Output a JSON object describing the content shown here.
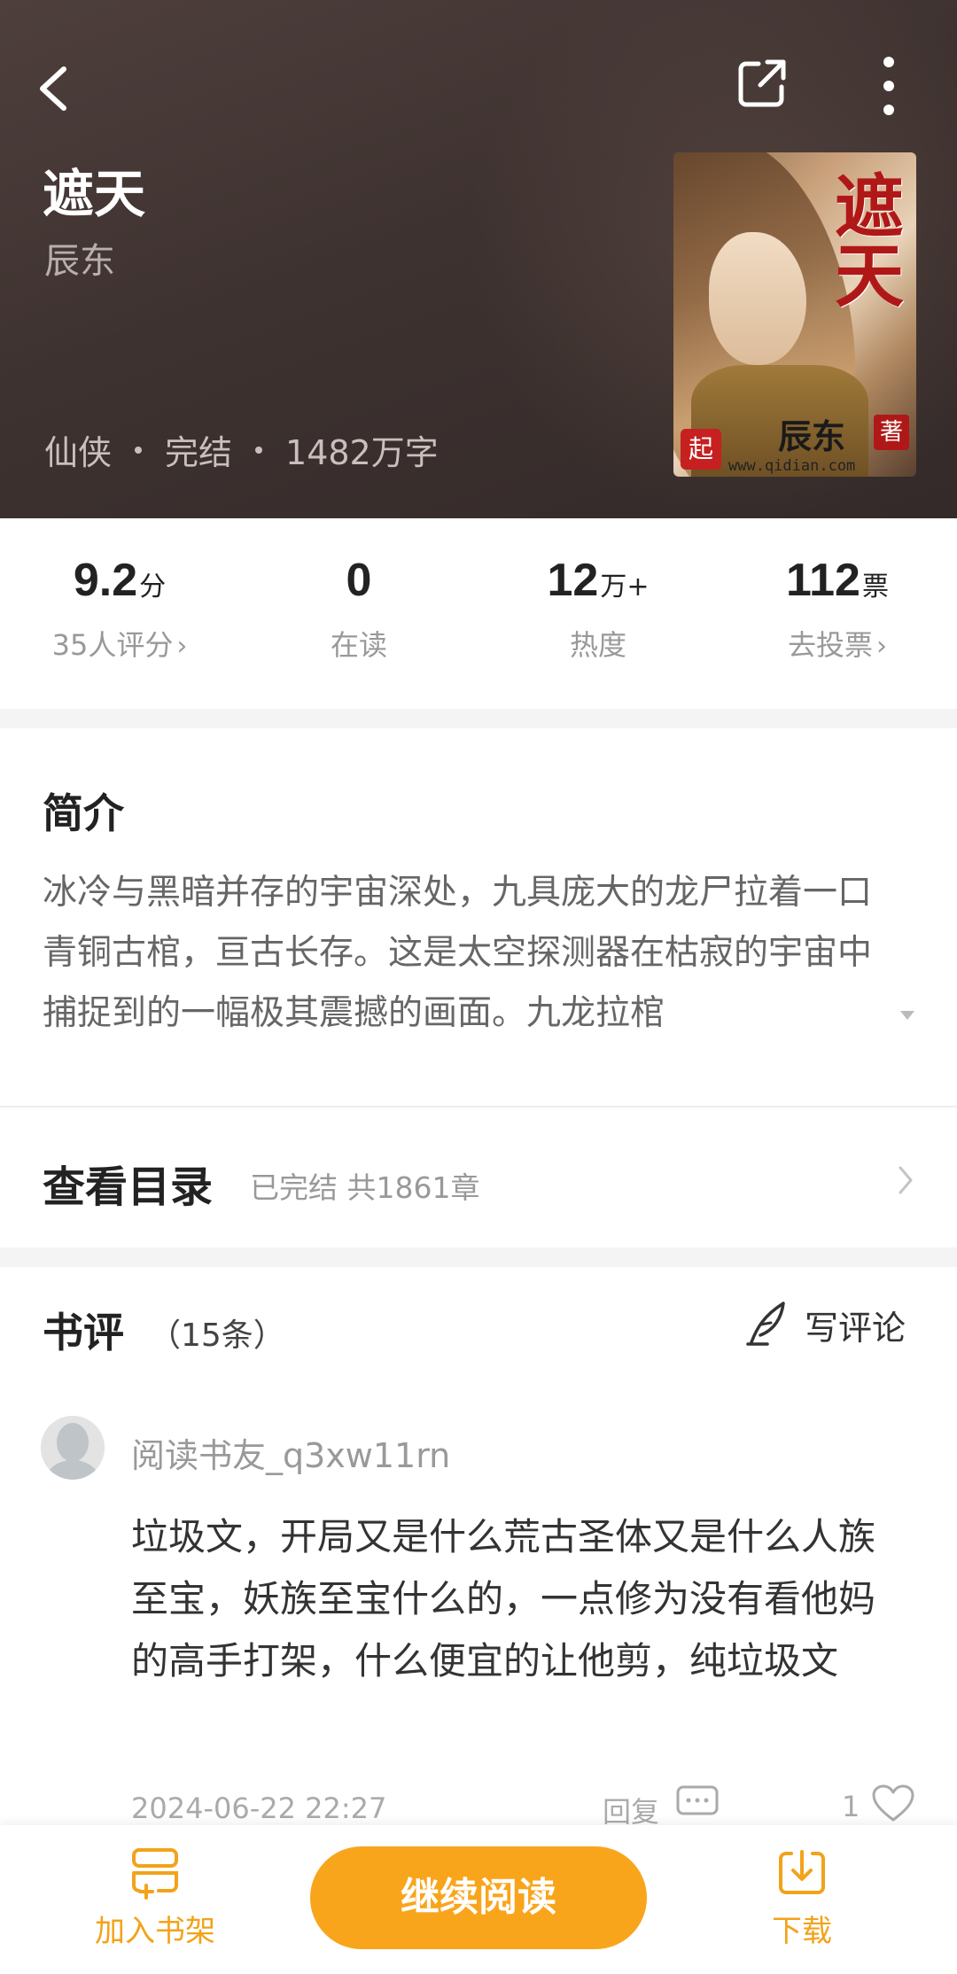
{
  "header": {
    "title": "遮天",
    "author": "辰东",
    "genre": "仙侠",
    "status": "完结",
    "word_count": "1482万字",
    "cover": {
      "title": "遮天",
      "author": "辰东",
      "zhu": "著",
      "seal": "起",
      "url": "www.qidian.com"
    }
  },
  "stats": {
    "rating": {
      "value": "9.2",
      "unit": "分",
      "label": "35人评分"
    },
    "reading": {
      "value": "0",
      "unit": "",
      "label": "在读"
    },
    "heat": {
      "value": "12",
      "unit": "万+",
      "label": "热度"
    },
    "votes": {
      "value": "112",
      "unit": "票",
      "label": "去投票"
    }
  },
  "intro": {
    "title": "简介",
    "text": "冰冷与黑暗并存的宇宙深处，九具庞大的龙尸拉着一口青铜古棺，亘古长存。这是太空探测器在枯寂的宇宙中捕捉到的一幅极其震撼的画面。九龙拉棺"
  },
  "catalog": {
    "title": "查看目录",
    "info": "已完结 共1861章"
  },
  "reviews": {
    "title": "书评",
    "count": "（15条）",
    "write_label": "写评论",
    "items": [
      {
        "username": "阅读书友_q3xw11rn",
        "body": "垃圾文，开局又是什么荒古圣体又是什么人族至宝，妖族至宝什么的，一点修为没有看他妈的高手打架，什么便宜的让他剪，纯垃圾文",
        "date": "2024-06-22 22:27",
        "reply_label": "回复",
        "likes": "1"
      }
    ]
  },
  "bottom_bar": {
    "shelf_label": "加入书架",
    "read_label": "继续阅读",
    "download_label": "下载"
  },
  "colors": {
    "accent": "#f9a51c",
    "header_bg": "#3e3230"
  }
}
